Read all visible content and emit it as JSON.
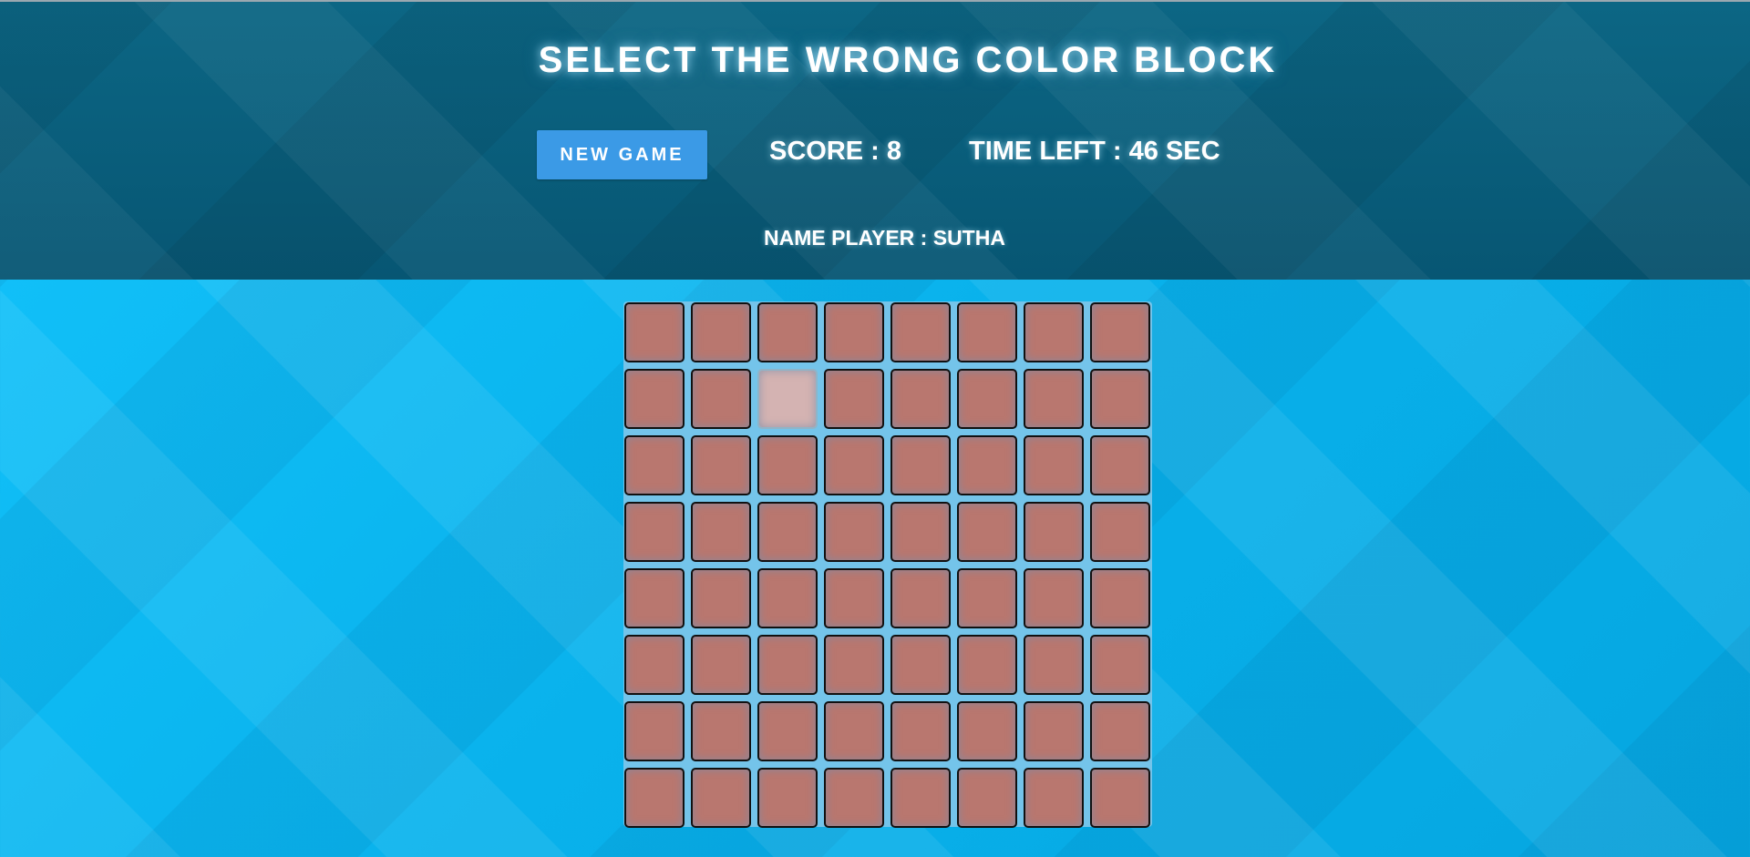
{
  "header": {
    "title": "SELECT THE WRONG COLOR BLOCK",
    "new_game_label": "NEW GAME",
    "score_text": "SCORE : 8",
    "time_text": "TIME LEFT : 46 SEC",
    "player_text": "NAME PLAYER : SUTHA"
  },
  "game": {
    "score": 8,
    "time_left_sec": 46,
    "player_name": "SUTHA",
    "grid_rows": 8,
    "grid_cols": 8,
    "odd_block": {
      "row": 2,
      "col": 3
    },
    "block_color": "#b9776f",
    "odd_block_color": "#d4b3b2"
  },
  "colors": {
    "header_bg": "#0a5c7b",
    "page_bg": "#0ab4ee",
    "button_bg": "#3b9ae6",
    "board_bg": "#74c4ea"
  }
}
